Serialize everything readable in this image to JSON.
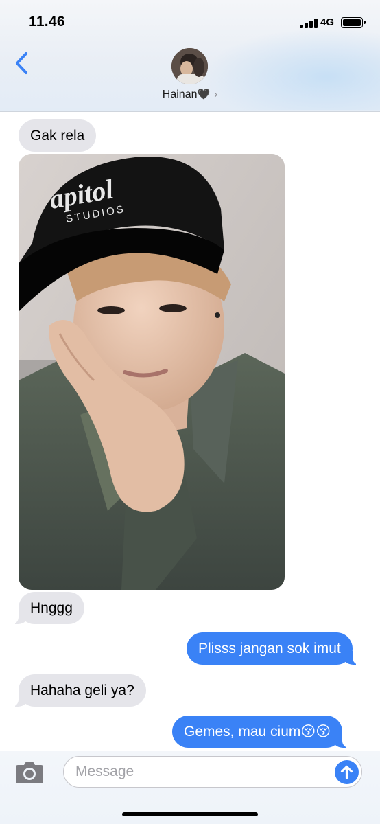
{
  "status_bar": {
    "time": "11.46",
    "network": "4G"
  },
  "header": {
    "contact_name": "Hainan",
    "contact_emoji": "🖤",
    "back_icon": "chevron-left-icon",
    "disclosure_icon": "chevron-right-icon"
  },
  "messages": [
    {
      "from": "contact",
      "type": "text",
      "text": "Gak rela"
    },
    {
      "from": "contact",
      "type": "photo",
      "subject": "selfie"
    },
    {
      "from": "contact",
      "type": "text",
      "text": "Hnggg"
    },
    {
      "from": "me",
      "type": "text",
      "text": "Plisss jangan sok imut"
    },
    {
      "from": "contact",
      "type": "text",
      "text": "Hahaha geli ya?"
    },
    {
      "from": "me",
      "type": "text",
      "text": "Gemes, mau cium😚😚"
    }
  ],
  "input_bar": {
    "placeholder": "Message",
    "value": "",
    "camera_icon": "camera-icon",
    "send_icon": "arrow-up-icon"
  },
  "colors": {
    "accent": "#3a82f6",
    "incoming_bubble": "#e5e5ea"
  }
}
